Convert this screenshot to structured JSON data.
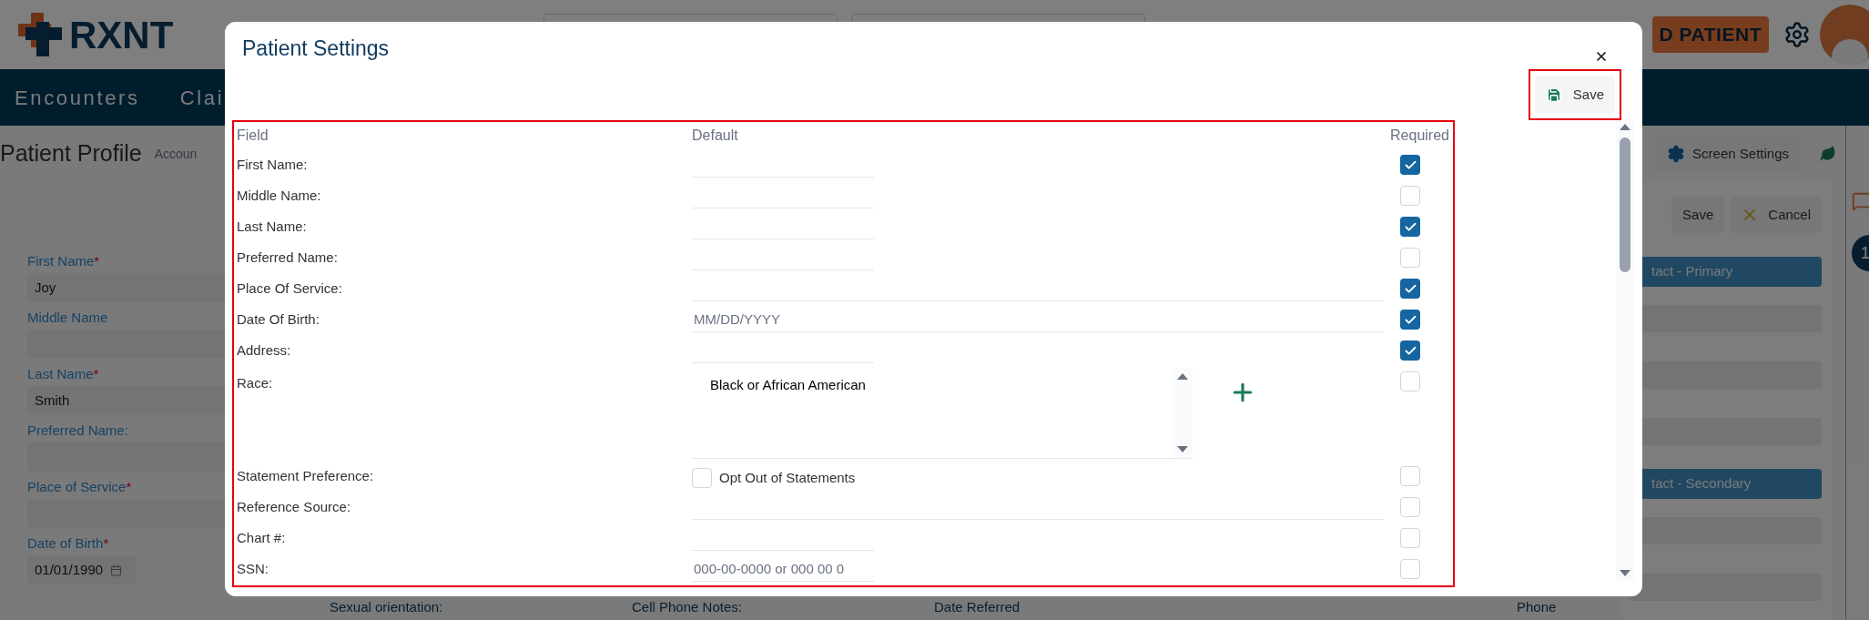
{
  "header": {
    "logo": "RXNT",
    "add_patient_button": "D PATIENT"
  },
  "nav": {
    "items": [
      {
        "label": "Encounters"
      },
      {
        "label": "Clai"
      }
    ]
  },
  "page": {
    "title": "Patient Profile",
    "breadcrumb": "Accoun",
    "screen_settings_button": "Screen Settings",
    "save_button": "Save",
    "cancel_button": "Cancel",
    "form": [
      {
        "label": "First Name",
        "asterisk": "*",
        "value": "Joy",
        "kind": "text"
      },
      {
        "label": "Middle Name",
        "kind": "text"
      },
      {
        "label": "Last Name",
        "asterisk": "*",
        "value": "Smith",
        "kind": "text"
      },
      {
        "label": "Preferred Name:",
        "kind": "text"
      },
      {
        "label": "Place of Service",
        "asterisk": "*",
        "kind": "text"
      },
      {
        "label": "Date of Birth",
        "asterisk": "*",
        "value": "01/01/1990",
        "kind": "date"
      }
    ],
    "contact_bars": [
      "tact - Primary",
      "tact - Secondary"
    ],
    "bottom_labels": [
      "Sexual orientation:",
      "Cell Phone Notes:",
      "Date Referred",
      "Phone"
    ],
    "badge": "1"
  },
  "dialog": {
    "title": "Patient Settings",
    "save_button": {
      "label": "Save",
      "highlighted": true
    },
    "table_highlighted": true,
    "columns": [
      "Field",
      "Default",
      "Required"
    ],
    "rows": [
      {
        "field": "First Name:",
        "kind": "short",
        "required": true
      },
      {
        "field": "Middle Name:",
        "kind": "short",
        "required": false
      },
      {
        "field": "Last Name:",
        "kind": "short",
        "required": true
      },
      {
        "field": "Preferred Name:",
        "kind": "short",
        "required": false
      },
      {
        "field": "Place Of Service:",
        "kind": "wide",
        "required": true
      },
      {
        "field": "Date Of Birth:",
        "kind": "wide",
        "placeholder": "MM/DD/YYYY",
        "required": true
      },
      {
        "field": "Address:",
        "kind": "short",
        "required": true
      },
      {
        "field": "Race:",
        "kind": "list",
        "items": [
          "Black or African American"
        ],
        "required": false
      },
      {
        "field": "Statement Preference:",
        "kind": "checkbox",
        "option": "Opt Out of Statements",
        "checked": false,
        "required": false
      },
      {
        "field": "Reference Source:",
        "kind": "wide",
        "required": false
      },
      {
        "field": "Chart #:",
        "kind": "short",
        "required": false
      },
      {
        "field": "SSN:",
        "kind": "short",
        "placeholder": "000-00-0000 or 000 00 0",
        "required": false
      }
    ]
  }
}
